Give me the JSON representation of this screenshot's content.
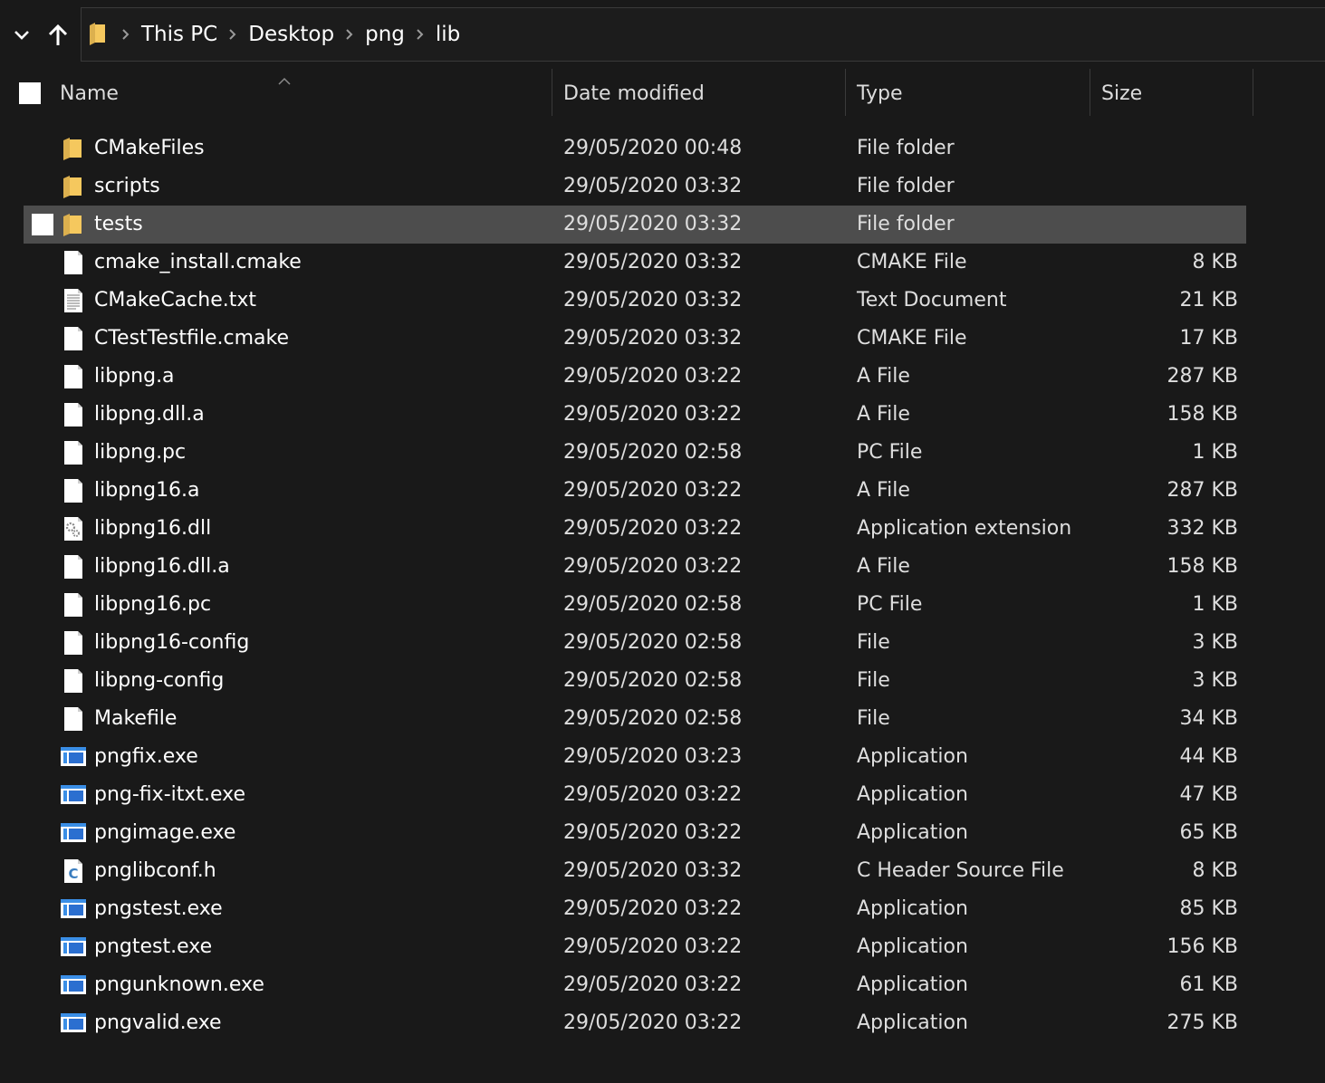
{
  "window": {
    "breadcrumbs": [
      "This PC",
      "Desktop",
      "png",
      "lib"
    ]
  },
  "columns": {
    "name": "Name",
    "date": "Date modified",
    "type": "Type",
    "size": "Size"
  },
  "selected_row": 2,
  "files": [
    {
      "name": "CMakeFiles",
      "date": "29/05/2020 00:48",
      "type": "File folder",
      "size": "",
      "icon": "folder-icon"
    },
    {
      "name": "scripts",
      "date": "29/05/2020 03:32",
      "type": "File folder",
      "size": "",
      "icon": "folder-icon"
    },
    {
      "name": "tests",
      "date": "29/05/2020 03:32",
      "type": "File folder",
      "size": "",
      "icon": "folder-icon"
    },
    {
      "name": "cmake_install.cmake",
      "date": "29/05/2020 03:32",
      "type": "CMAKE File",
      "size": "8 KB",
      "icon": "file-icon"
    },
    {
      "name": "CMakeCache.txt",
      "date": "29/05/2020 03:32",
      "type": "Text Document",
      "size": "21 KB",
      "icon": "text-file-icon"
    },
    {
      "name": "CTestTestfile.cmake",
      "date": "29/05/2020 03:32",
      "type": "CMAKE File",
      "size": "17 KB",
      "icon": "file-icon"
    },
    {
      "name": "libpng.a",
      "date": "29/05/2020 03:22",
      "type": "A File",
      "size": "287 KB",
      "icon": "file-icon"
    },
    {
      "name": "libpng.dll.a",
      "date": "29/05/2020 03:22",
      "type": "A File",
      "size": "158 KB",
      "icon": "file-icon"
    },
    {
      "name": "libpng.pc",
      "date": "29/05/2020 02:58",
      "type": "PC File",
      "size": "1 KB",
      "icon": "file-icon"
    },
    {
      "name": "libpng16.a",
      "date": "29/05/2020 03:22",
      "type": "A File",
      "size": "287 KB",
      "icon": "file-icon"
    },
    {
      "name": "libpng16.dll",
      "date": "29/05/2020 03:22",
      "type": "Application extension",
      "size": "332 KB",
      "icon": "dll-file-icon"
    },
    {
      "name": "libpng16.dll.a",
      "date": "29/05/2020 03:22",
      "type": "A File",
      "size": "158 KB",
      "icon": "file-icon"
    },
    {
      "name": "libpng16.pc",
      "date": "29/05/2020 02:58",
      "type": "PC File",
      "size": "1 KB",
      "icon": "file-icon"
    },
    {
      "name": "libpng16-config",
      "date": "29/05/2020 02:58",
      "type": "File",
      "size": "3 KB",
      "icon": "file-icon"
    },
    {
      "name": "libpng-config",
      "date": "29/05/2020 02:58",
      "type": "File",
      "size": "3 KB",
      "icon": "file-icon"
    },
    {
      "name": "Makefile",
      "date": "29/05/2020 02:58",
      "type": "File",
      "size": "34 KB",
      "icon": "file-icon"
    },
    {
      "name": "pngfix.exe",
      "date": "29/05/2020 03:23",
      "type": "Application",
      "size": "44 KB",
      "icon": "exe-icon"
    },
    {
      "name": "png-fix-itxt.exe",
      "date": "29/05/2020 03:22",
      "type": "Application",
      "size": "47 KB",
      "icon": "exe-icon"
    },
    {
      "name": "pngimage.exe",
      "date": "29/05/2020 03:22",
      "type": "Application",
      "size": "65 KB",
      "icon": "exe-icon"
    },
    {
      "name": "pnglibconf.h",
      "date": "29/05/2020 03:32",
      "type": "C Header Source File",
      "size": "8 KB",
      "icon": "c-header-icon"
    },
    {
      "name": "pngstest.exe",
      "date": "29/05/2020 03:22",
      "type": "Application",
      "size": "85 KB",
      "icon": "exe-icon"
    },
    {
      "name": "pngtest.exe",
      "date": "29/05/2020 03:22",
      "type": "Application",
      "size": "156 KB",
      "icon": "exe-icon"
    },
    {
      "name": "pngunknown.exe",
      "date": "29/05/2020 03:22",
      "type": "Application",
      "size": "61 KB",
      "icon": "exe-icon"
    },
    {
      "name": "pngvalid.exe",
      "date": "29/05/2020 03:22",
      "type": "Application",
      "size": "275 KB",
      "icon": "exe-icon"
    }
  ]
}
